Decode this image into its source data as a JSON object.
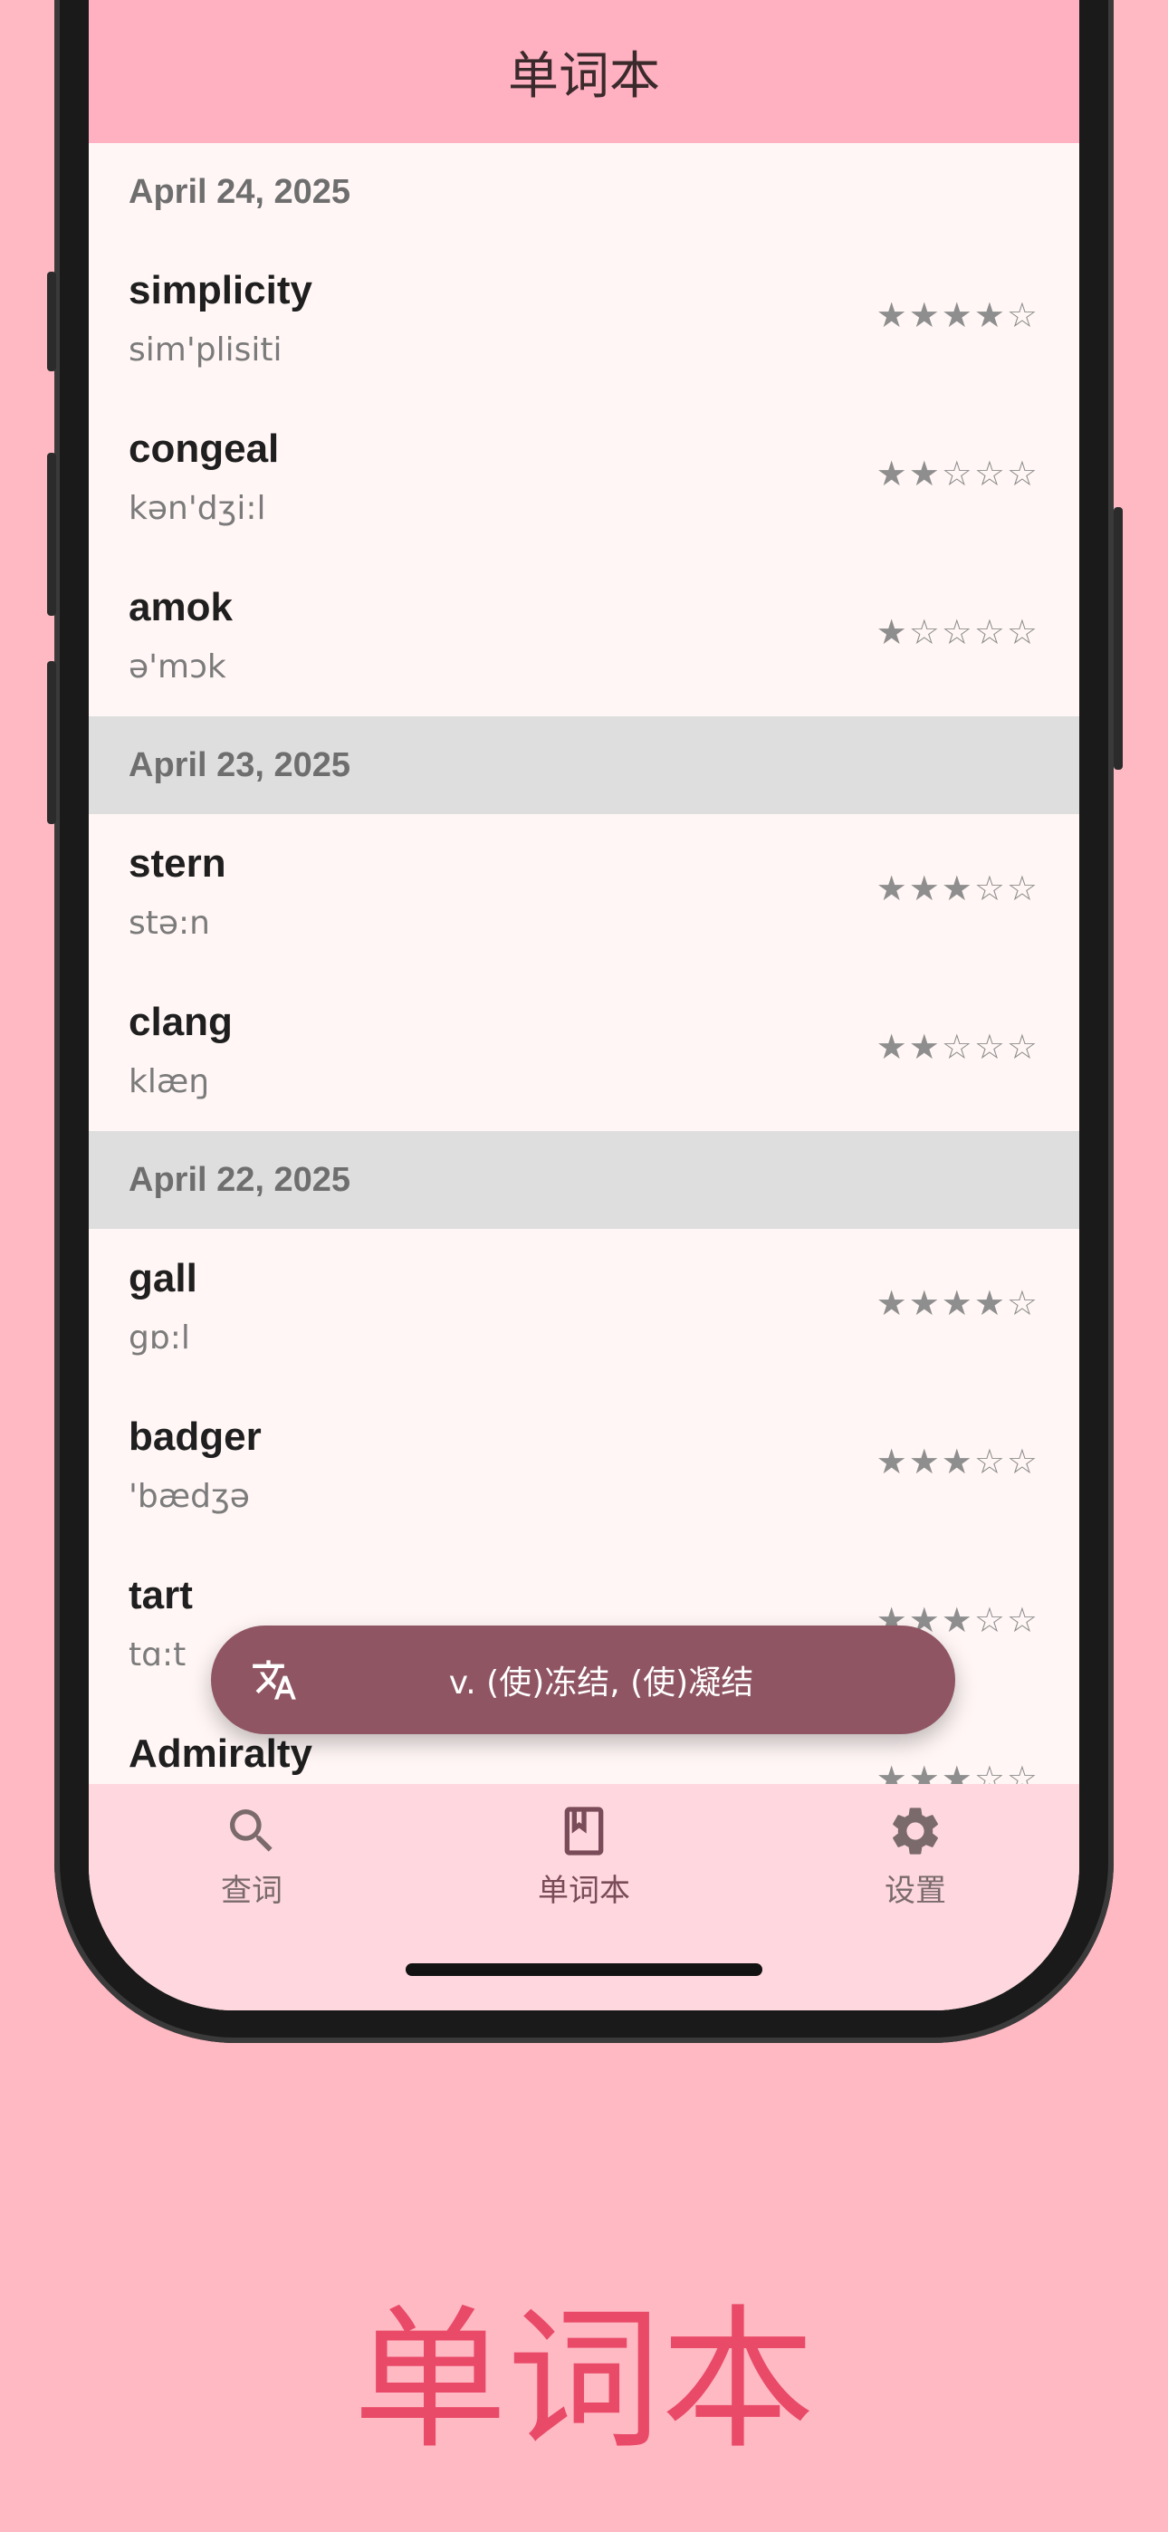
{
  "app": {
    "title": "单词本"
  },
  "caption": "单词本",
  "groups": [
    {
      "date": "April 24, 2025",
      "words": [
        {
          "word": "simplicity",
          "phonetic": "sim'plisiti",
          "rating": 4
        },
        {
          "word": "congeal",
          "phonetic": "kən'dʒi:l",
          "rating": 2
        },
        {
          "word": "amok",
          "phonetic": "ə'mɔk",
          "rating": 1
        }
      ]
    },
    {
      "date": "April 23, 2025",
      "words": [
        {
          "word": "stern",
          "phonetic": "stə:n",
          "rating": 3
        },
        {
          "word": "clang",
          "phonetic": "klæŋ",
          "rating": 2
        }
      ]
    },
    {
      "date": "April 22, 2025",
      "words": [
        {
          "word": "gall",
          "phonetic": "gɒ:l",
          "rating": 4
        },
        {
          "word": "badger",
          "phonetic": "'bædʒə",
          "rating": 3
        },
        {
          "word": "tart",
          "phonetic": "tɑ:t",
          "rating": 3
        },
        {
          "word": "Admiralty",
          "phonetic": "",
          "rating": 3
        }
      ]
    }
  ],
  "rating_max": 5,
  "snackbar": {
    "text": "v. (使)冻结, (使)凝结",
    "icon": "translate-icon"
  },
  "nav": [
    {
      "label": "查词",
      "icon": "search-icon",
      "active": false
    },
    {
      "label": "单词本",
      "icon": "book-icon",
      "active": true
    },
    {
      "label": "设置",
      "icon": "gear-icon",
      "active": false
    }
  ],
  "colors": {
    "background": "#ffb9c3",
    "header": "#ffb0c1",
    "snackbar": "#8f5563",
    "caption": "#e94a68"
  }
}
